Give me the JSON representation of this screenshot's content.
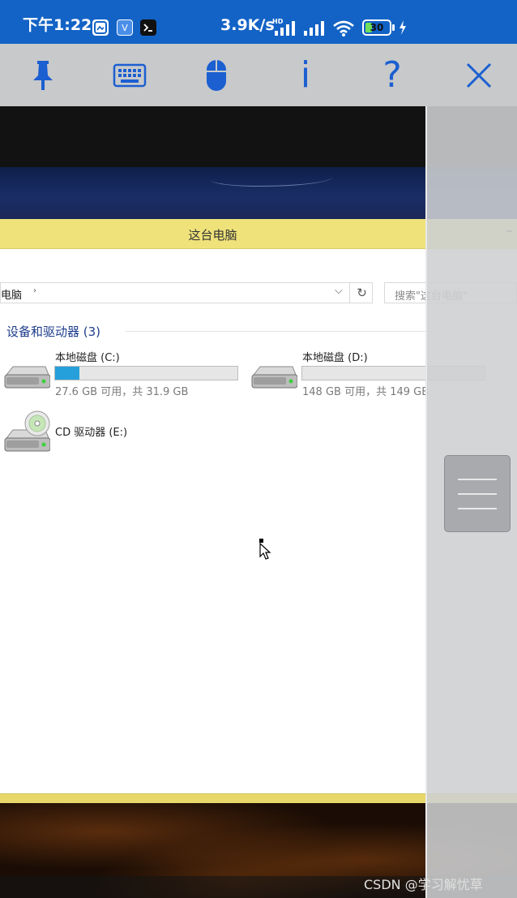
{
  "status_bar": {
    "time": "下午1:22",
    "speed": "3.9K/s",
    "network": "HD",
    "battery": "30",
    "battery_level": 0.3,
    "icons": [
      "gallery-app-icon",
      "vpn-app-icon",
      "terminal-app-icon",
      "signal-icon",
      "wifi-icon",
      "battery-icon",
      "charging-icon"
    ]
  },
  "toolbar": {
    "buttons": [
      {
        "name": "pin-icon"
      },
      {
        "name": "keyboard-icon"
      },
      {
        "name": "mouse-icon"
      },
      {
        "name": "info",
        "label": "i"
      },
      {
        "name": "help",
        "label": "?"
      },
      {
        "name": "close-icon"
      }
    ],
    "accent": "#1b5fd1"
  },
  "explorer": {
    "title": "这台电脑",
    "minimize": "–",
    "address": {
      "crumb": "电脑",
      "arrow": "›",
      "dropdown": "⌵",
      "refresh": "↻"
    },
    "search_placeholder": "搜索\"这台电脑\"",
    "group_header": "设备和驱动器 (3)",
    "drives": [
      {
        "name": "本地磁盘 (C:)",
        "info": "27.6 GB 可用，共 31.9 GB",
        "used_fraction": 0.135
      },
      {
        "name": "本地磁盘 (D:)",
        "info": "148 GB 可用，共 149 GB",
        "used_fraction": 0.0
      },
      {
        "name": "CD 驱动器 (E:)"
      }
    ]
  },
  "watermark": "CSDN @学习解忧草"
}
